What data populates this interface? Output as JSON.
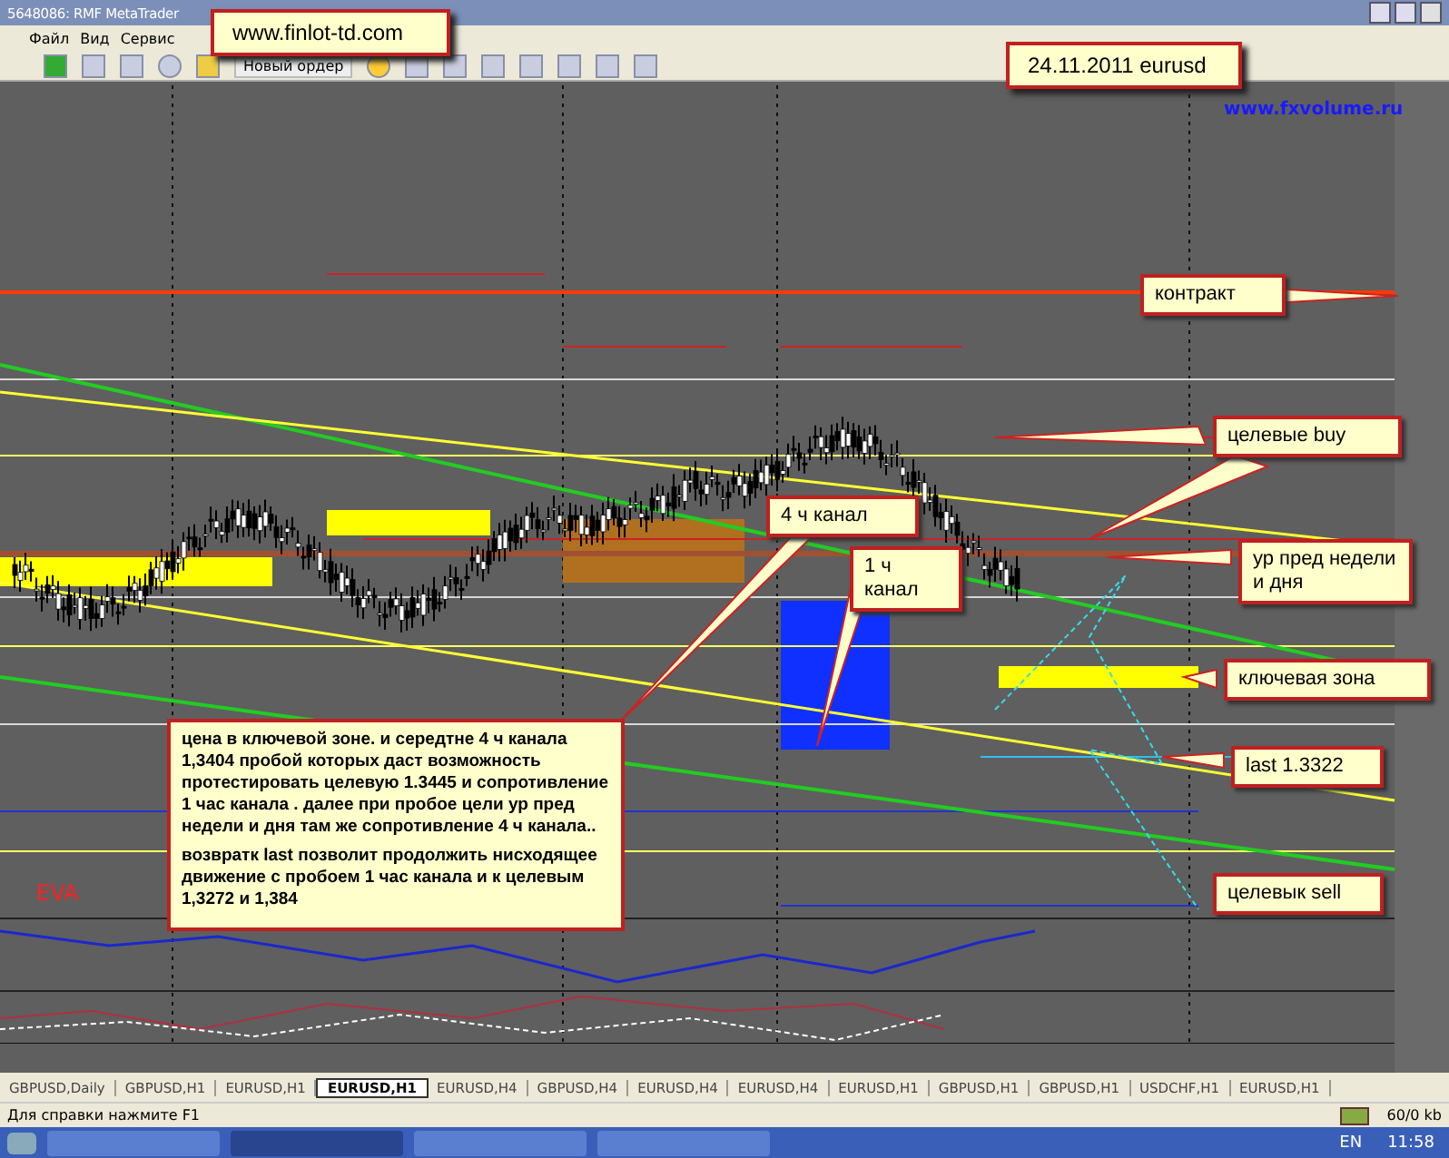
{
  "window": {
    "title": "5648086: RMF MetaTrader"
  },
  "menu": [
    "Файл",
    "Вид",
    "Сервис"
  ],
  "toolbar": {
    "new_order": "Новый ордер"
  },
  "chart": {
    "site_label": "www.fxvolume.ru",
    "eva_label": "EVA",
    "callouts": [
      {
        "kind": "banner",
        "text": "www.finlot-td.com"
      },
      {
        "kind": "banner",
        "text": "24.11.2011 eurusd"
      },
      {
        "kind": "note",
        "text": "контракт"
      },
      {
        "kind": "note",
        "text": "целевые buy"
      },
      {
        "kind": "note",
        "text": "4 ч канал"
      },
      {
        "kind": "note",
        "text": "1 ч канал"
      },
      {
        "kind": "note",
        "text": "ур пред недели и дня"
      },
      {
        "kind": "note",
        "text": "ключевая зона"
      },
      {
        "kind": "note",
        "text": "last 1.3322"
      },
      {
        "kind": "note",
        "text": "целевык sell"
      }
    ],
    "comment": [
      "цена  в  ключевой зоне. и середтне 4 ч канала 1,3404 пробой которых даст возможность протестировать  целевую 1.3445 и сопротивление 1 час канала . далее при пробое  цели  ур  пред недели и дня  там же сопротивление 4 ч канала..",
      "  возвратк  last  позволит продолжить нисходящее движение   с пробоем 1 час канала и к целевым 1,3272 и 1,384"
    ]
  },
  "tabs": [
    {
      "label": "GBPUSD,Daily",
      "selected": false
    },
    {
      "label": "GBPUSD,H1",
      "selected": false
    },
    {
      "label": "EURUSD,H1",
      "selected": false
    },
    {
      "label": "EURUSD,H1",
      "selected": true
    },
    {
      "label": "EURUSD,H4",
      "selected": false
    },
    {
      "label": "GBPUSD,H4",
      "selected": false
    },
    {
      "label": "EURUSD,H4",
      "selected": false
    },
    {
      "label": "EURUSD,H4",
      "selected": false
    },
    {
      "label": "EURUSD,H1",
      "selected": false
    },
    {
      "label": "GBPUSD,H1",
      "selected": false
    },
    {
      "label": "GBPUSD,H1",
      "selected": false
    },
    {
      "label": "USDCHF,H1",
      "selected": false
    },
    {
      "label": "EURUSD,H1",
      "selected": false
    }
  ],
  "status_bar": {
    "help": "Для справки нажмите F1",
    "traffic": "60/0 kb"
  },
  "taskbar": {
    "language": "EN",
    "clock": "11:58"
  }
}
